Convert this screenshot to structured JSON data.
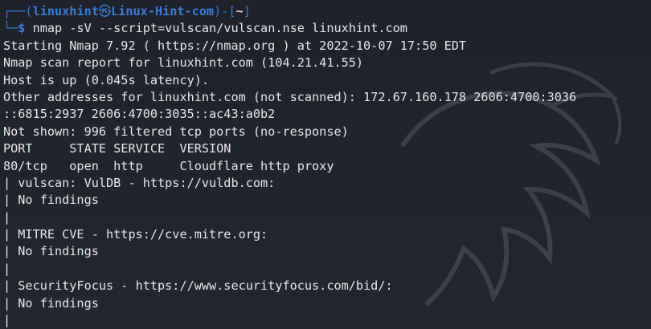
{
  "prompt": {
    "open": "┌──(",
    "user": "linuxhint",
    "at": "㉿",
    "host": "Linux-Hint-com",
    "close_mid": ")-[",
    "dir": "~",
    "close": "]",
    "second_prefix": "└─",
    "sign": "$",
    "command": " nmap -sV --script=vulscan/vulscan.nse linuxhint.com"
  },
  "output_lines": [
    "Starting Nmap 7.92 ( https://nmap.org ) at 2022-10-07 17:50 EDT",
    "Nmap scan report for linuxhint.com (104.21.41.55)",
    "Host is up (0.045s latency).",
    "Other addresses for linuxhint.com (not scanned): 172.67.160.178 2606:4700:3036",
    "::6815:2937 2606:4700:3035::ac43:a0b2",
    "Not shown: 996 filtered tcp ports (no-response)",
    "PORT     STATE SERVICE  VERSION",
    "80/tcp   open  http     Cloudflare http proxy",
    "| vulscan: VulDB - https://vuldb.com:",
    "| No findings",
    "|",
    "| MITRE CVE - https://cve.mitre.org:",
    "| No findings",
    "|",
    "| SecurityFocus - https://www.securityfocus.com/bid/:",
    "| No findings",
    "|"
  ],
  "colors": {
    "background": "#20232b",
    "prompt_accent": "#3a7bd5",
    "text": "#e6e6e6"
  },
  "watermark_icon": "dragon-watermark-icon"
}
